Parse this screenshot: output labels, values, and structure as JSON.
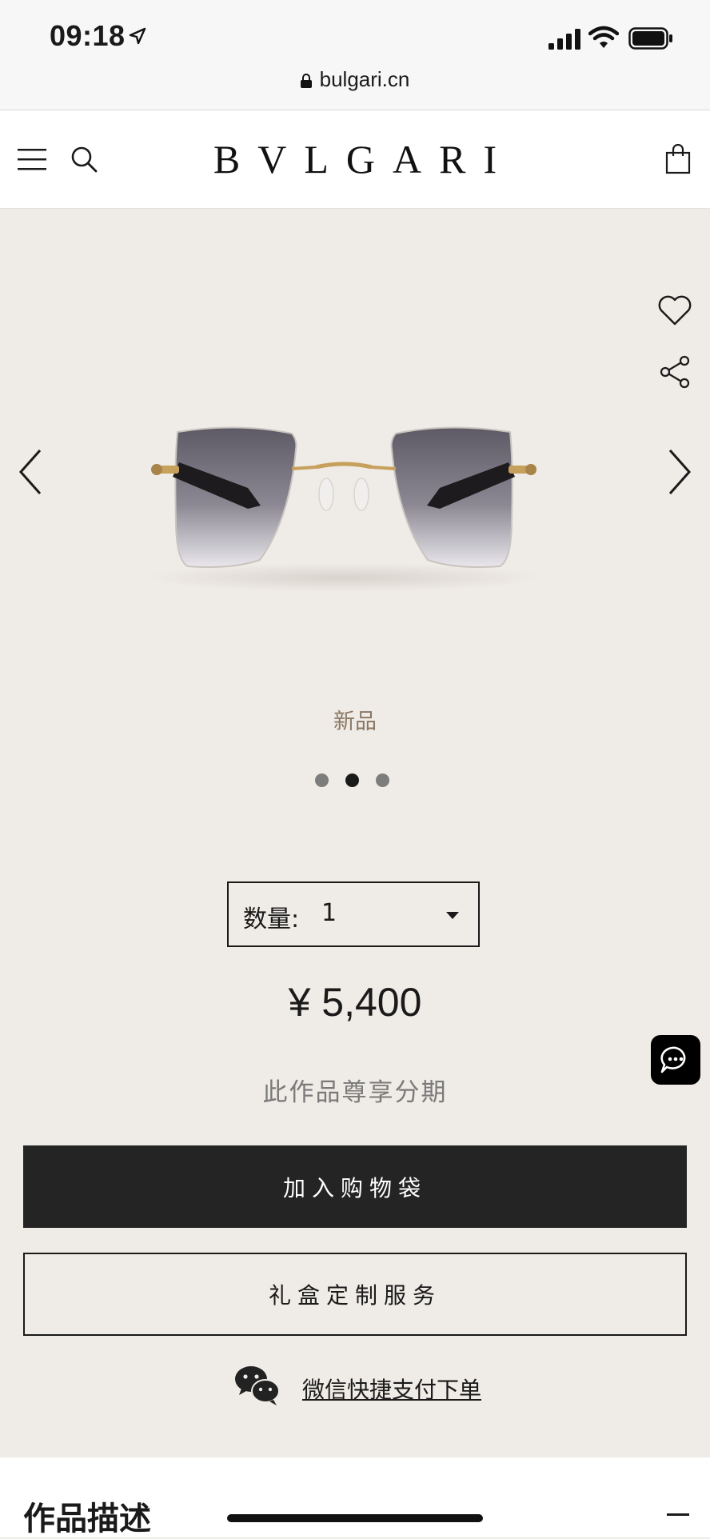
{
  "status_bar": {
    "time": "09:18",
    "url": "bulgari.cn"
  },
  "header": {
    "logo": "BVLGARI"
  },
  "product": {
    "badge": "新品",
    "gallery_dots": 3,
    "active_dot": 2,
    "quantity_label": "数量:",
    "quantity_value": "1",
    "price": "¥ 5,400",
    "installment_text": "此作品尊享分期"
  },
  "actions": {
    "add_to_bag": "加入购物袋",
    "gift_box": "礼盒定制服务",
    "wechat_pay": "微信快捷支付下单"
  },
  "description": {
    "title": "作品描述"
  },
  "colors": {
    "background": "#efebe6",
    "primary_button": "#242424",
    "badge_text": "#8a7763"
  }
}
